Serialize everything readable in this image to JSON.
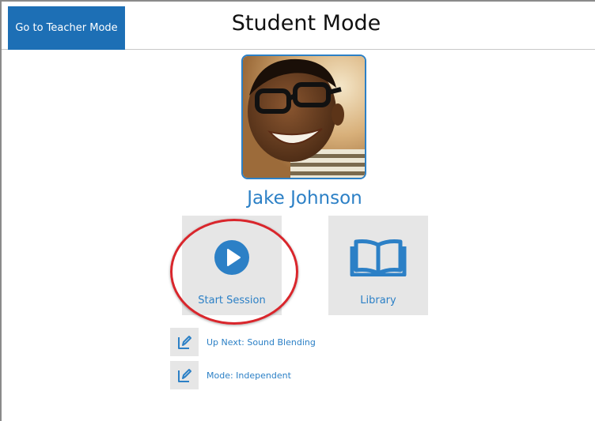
{
  "header": {
    "teacher_button_label": "Go to Teacher Mode",
    "title": "Student Mode"
  },
  "student": {
    "name": "Jake Johnson",
    "photo": "student-photo"
  },
  "actions": {
    "start_session_label": "Start Session",
    "start_icon": "play-icon",
    "library_label": "Library",
    "library_icon": "book-icon"
  },
  "options": {
    "up_next": "Up Next: Sound Blending",
    "mode": "Mode: Independent",
    "edit_icon": "edit-icon"
  },
  "colors": {
    "accent": "#2c80c6",
    "teacher_button": "#1d6fb5",
    "highlight": "#d9262c",
    "tile_bg": "#e6e6e6"
  }
}
